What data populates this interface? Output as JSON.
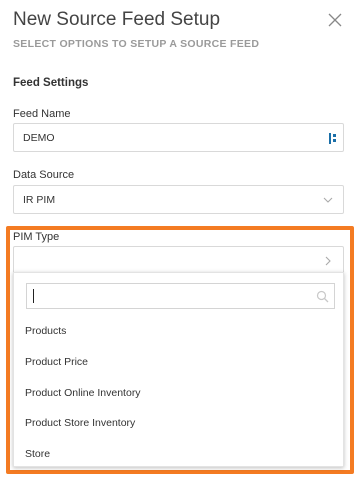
{
  "header": {
    "title": "New Source Feed Setup",
    "subtitle": "SELECT OPTIONS TO SETUP A SOURCE FEED"
  },
  "section": {
    "title": "Feed Settings"
  },
  "feed_name": {
    "label": "Feed Name",
    "value": "DEMO"
  },
  "data_source": {
    "label": "Data Source",
    "value": "IR PIM"
  },
  "pim_type": {
    "label": "PIM Type",
    "value": "",
    "search_value": "",
    "options": [
      "Products",
      "Product Price",
      "Product Online Inventory",
      "Product Store Inventory",
      "Store"
    ]
  },
  "colors": {
    "highlight": "#f47b22",
    "border": "#d9d9d9",
    "icon": "#1a6fa8"
  },
  "icons": [
    "close-icon",
    "feed-icon",
    "chevron-down-icon",
    "chevron-right-icon",
    "search-icon"
  ]
}
